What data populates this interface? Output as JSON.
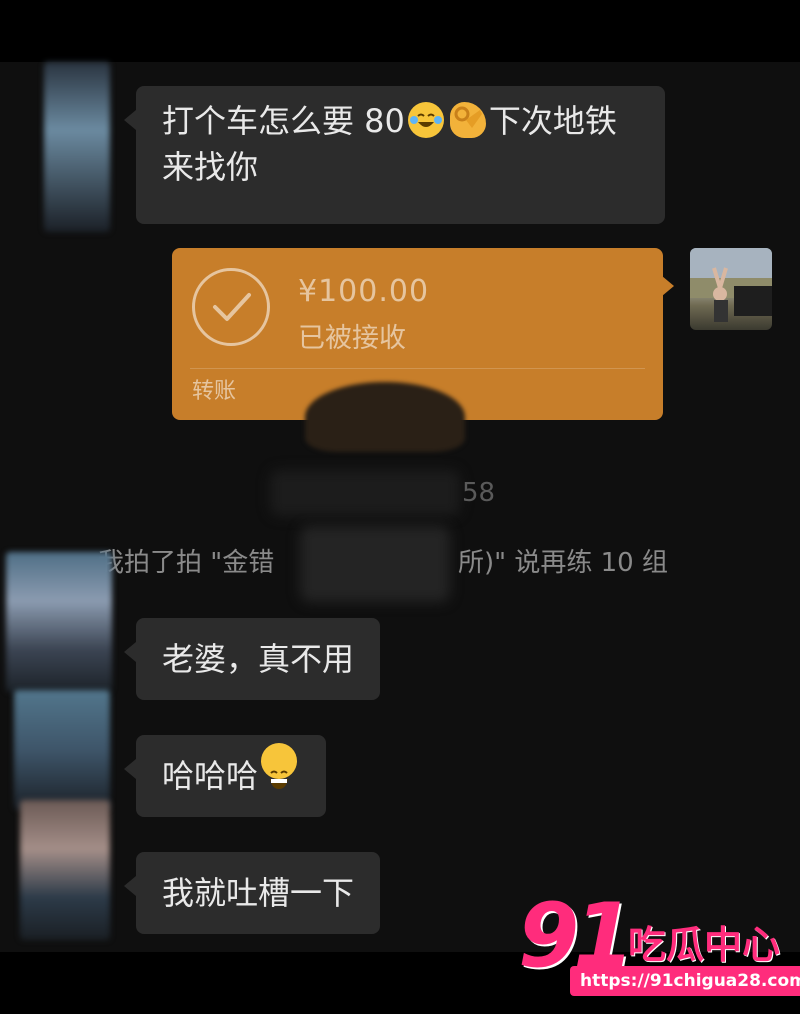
{
  "messages": [
    {
      "line1": "打个车怎么要 80",
      "after_emojis": "下次地铁",
      "line2": "来找你"
    },
    {
      "text": "老婆，真不用"
    },
    {
      "text": "哈哈哈"
    },
    {
      "text": "我就吐槽一下"
    }
  ],
  "transfer": {
    "amount": "¥100.00",
    "status": "已被接收",
    "type_label": "转账"
  },
  "timestamp": "58",
  "pat_notice": {
    "prefix": "我拍了拍 \"金错",
    "suffix": "所)\" 说再练 10 组"
  },
  "watermark": {
    "number": "91",
    "name": "吃瓜中心",
    "url": "https://91chigua28.com"
  },
  "colors": {
    "transfer_orange": "#c77e2a",
    "bubble_gray": "#2c2c2c",
    "watermark_pink": "#ff2c7c"
  },
  "icons": [
    "crying-laughing-emoji",
    "ok-hand-emoji",
    "grinning-emoji",
    "check-circle-icon"
  ]
}
